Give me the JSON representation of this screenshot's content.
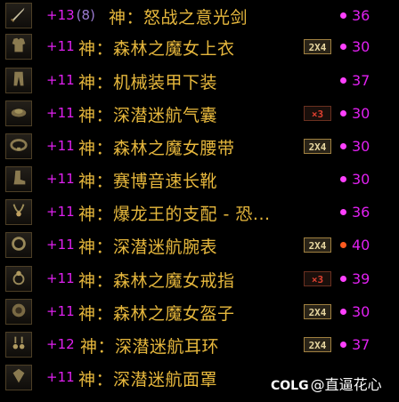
{
  "colors": {
    "level": "#e020f0",
    "name": "#e7b83d",
    "dot_magenta": "#ff40ff",
    "dot_orange": "#ff5a1f"
  },
  "items": [
    {
      "level": "+13",
      "sub": "(8)",
      "name": "神：怒战之意光剑",
      "badge": "",
      "dot": "magenta",
      "score": "36",
      "icon": "sword-icon"
    },
    {
      "level": "+11",
      "sub": "",
      "name": "神：森林之魔女上衣",
      "badge": "2X4",
      "dot": "magenta",
      "score": "30",
      "icon": "top-armor-icon"
    },
    {
      "level": "+11",
      "sub": "",
      "name": "神：机械装甲下装",
      "badge": "",
      "dot": "magenta",
      "score": "37",
      "icon": "pants-icon"
    },
    {
      "level": "+11",
      "sub": "",
      "name": "神：深潜迷航气囊",
      "badge": "×3",
      "dot": "magenta",
      "score": "30",
      "icon": "shoulder-icon"
    },
    {
      "level": "+11",
      "sub": "",
      "name": "神：森林之魔女腰带",
      "badge": "2X4",
      "dot": "magenta",
      "score": "30",
      "icon": "belt-icon"
    },
    {
      "level": "+11",
      "sub": "",
      "name": "神：赛博音速长靴",
      "badge": "",
      "dot": "magenta",
      "score": "30",
      "icon": "boots-icon"
    },
    {
      "level": "+11",
      "sub": "",
      "name": "神：爆龙王的支配 - 恐...",
      "badge": "",
      "dot": "magenta",
      "score": "36",
      "icon": "necklace-icon"
    },
    {
      "level": "+11",
      "sub": "",
      "name": "神：深潜迷航腕表",
      "badge": "2X4",
      "dot": "orange",
      "score": "40",
      "icon": "bracelet-icon"
    },
    {
      "level": "+11",
      "sub": "",
      "name": "神：森林之魔女戒指",
      "badge": "×3",
      "dot": "magenta",
      "score": "39",
      "icon": "ring-icon"
    },
    {
      "level": "+11",
      "sub": "",
      "name": "神：森林之魔女盔子",
      "badge": "2X4",
      "dot": "magenta",
      "score": "30",
      "icon": "orb-icon"
    },
    {
      "level": "+12",
      "sub": "",
      "name": "神：深潜迷航耳环",
      "badge": "2X4",
      "dot": "magenta",
      "score": "37",
      "icon": "earring-icon"
    },
    {
      "level": "+11",
      "sub": "",
      "name": "神：深潜迷航面罩",
      "badge": "",
      "dot": "",
      "score": "",
      "icon": "gem-icon"
    }
  ],
  "watermark": {
    "logo": "COLG",
    "text": "@直逼花心"
  }
}
